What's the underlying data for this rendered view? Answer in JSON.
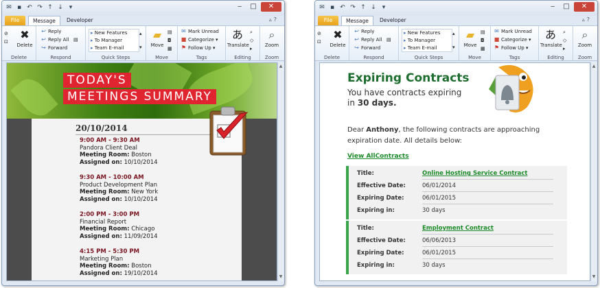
{
  "ribbon": {
    "tabs": [
      "File",
      "Message",
      "Developer"
    ],
    "groups": {
      "delete": {
        "label": "Delete",
        "button": "Delete"
      },
      "respond": {
        "label": "Respond",
        "reply": "Reply",
        "reply_all": "Reply All",
        "forward": "Forward"
      },
      "quick_steps": {
        "label": "Quick Steps",
        "items": [
          "New Features",
          "To Manager",
          "Team E-mail"
        ]
      },
      "move": {
        "label": "Move",
        "button": "Move"
      },
      "tags": {
        "label": "Tags",
        "mark_unread": "Mark Unread",
        "categorize": "Categorize",
        "follow_up": "Follow Up"
      },
      "editing": {
        "label": "Editing",
        "button": "Translate"
      },
      "zoom": {
        "label": "Zoom",
        "button": "Zoom"
      }
    }
  },
  "meetings": {
    "banner_line1": "TODAY'S",
    "banner_line2": "MEETINGS SUMMARY",
    "date": "20/10/2014",
    "items": [
      {
        "time": "9:00 AM - 9:30 AM",
        "title": "Pandora Client Deal",
        "room_label": "Meeting Room:",
        "room": "Boston",
        "assigned_label": "Assigned on:",
        "assigned": "10/10/2014"
      },
      {
        "time": "9:30 AM - 10:00 AM",
        "title": "Product Development Plan",
        "room_label": "Meeting Room:",
        "room": "New York",
        "assigned_label": "Assigned on:",
        "assigned": "10/10/2014"
      },
      {
        "time": "2:00 PM - 3:00 PM",
        "title": "Financial Report",
        "room_label": "Meeting Room:",
        "room": "Chicago",
        "assigned_label": "Assigned on:",
        "assigned": "11/09/2014"
      },
      {
        "time": "4:15 PM - 5:30 PM",
        "title": "Marketing Plan",
        "room_label": "Meeting Room:",
        "room": "Boston",
        "assigned_label": "Assigned on:",
        "assigned": "19/10/2014"
      }
    ]
  },
  "contracts": {
    "title": "Expiring Contracts",
    "subtitle_pre": "You have contracts expiring",
    "subtitle_in": "in",
    "subtitle_days": "30 days.",
    "greeting_pre": "Dear",
    "name": "Anthony",
    "greeting_post": ", the following contracts are approaching expiration date. All details below:",
    "view_all": "View AllContracts",
    "labels": {
      "title": "Title:",
      "effective": "Effective Date:",
      "expiring": "Expiring Date:",
      "expiring_in": "Expiring in:"
    },
    "items": [
      {
        "title": "Online Hosting Service Contract",
        "effective": "06/01/2014",
        "expiring": "06/01/2015",
        "expiring_in": "30 days"
      },
      {
        "title": "Employment Contract",
        "effective": "06/06/2013",
        "expiring": "06/01/2015",
        "expiring_in": "30 days"
      }
    ]
  },
  "colors": {
    "accent_green": "#1d6e2e",
    "link_green": "#1c8a2a",
    "banner_red": "#e02531",
    "time_red": "#7a1620"
  }
}
